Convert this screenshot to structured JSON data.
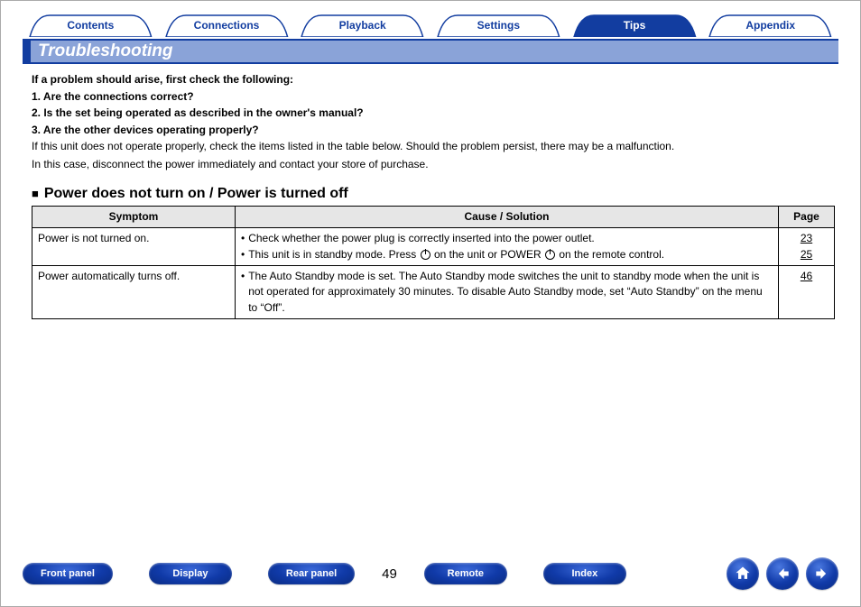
{
  "tabs": [
    "Contents",
    "Connections",
    "Playback",
    "Settings",
    "Tips",
    "Appendix"
  ],
  "active_tab_index": 4,
  "title": "Troubleshooting",
  "intro": {
    "lead": "If a problem should arise, first check the following:",
    "items": [
      "1. Are the connections correct?",
      "2. Is the set being operated as described in the owner's manual?",
      "3. Are the other devices operating properly?"
    ],
    "para1": "If this unit does not operate properly, check the items listed in the table below. Should the problem persist, there may be a malfunction.",
    "para2": "In this case, disconnect the power immediately and contact your store of purchase."
  },
  "section_head": "Power does not turn on / Power is turned off",
  "table": {
    "headers": [
      "Symptom",
      "Cause / Solution",
      "Page"
    ],
    "rows": [
      {
        "symptom": "Power is not turned on.",
        "causes": [
          {
            "text_before": "Check whether the power plug is correctly inserted into the power outlet.",
            "text_mid": "",
            "text_after": "",
            "has_power_icons": false
          },
          {
            "text_before": "This unit is in standby mode. Press ",
            "text_mid": " on the unit or POWER ",
            "text_after": " on the remote control.",
            "has_power_icons": true
          }
        ],
        "pages": [
          "23",
          "25"
        ]
      },
      {
        "symptom": "Power automatically turns off.",
        "causes": [
          {
            "text_before": "The Auto Standby mode is set. The Auto Standby mode switches the unit to standby mode when the unit is not operated for approximately 30 minutes. To disable Auto Standby mode, set “Auto Standby” on the menu to “Off”.",
            "text_mid": "",
            "text_after": "",
            "has_power_icons": false
          }
        ],
        "pages": [
          "46"
        ]
      }
    ]
  },
  "bottom": {
    "buttons_left": [
      "Front panel",
      "Display",
      "Rear panel"
    ],
    "buttons_right": [
      "Remote",
      "Index"
    ],
    "page_number": "49"
  }
}
